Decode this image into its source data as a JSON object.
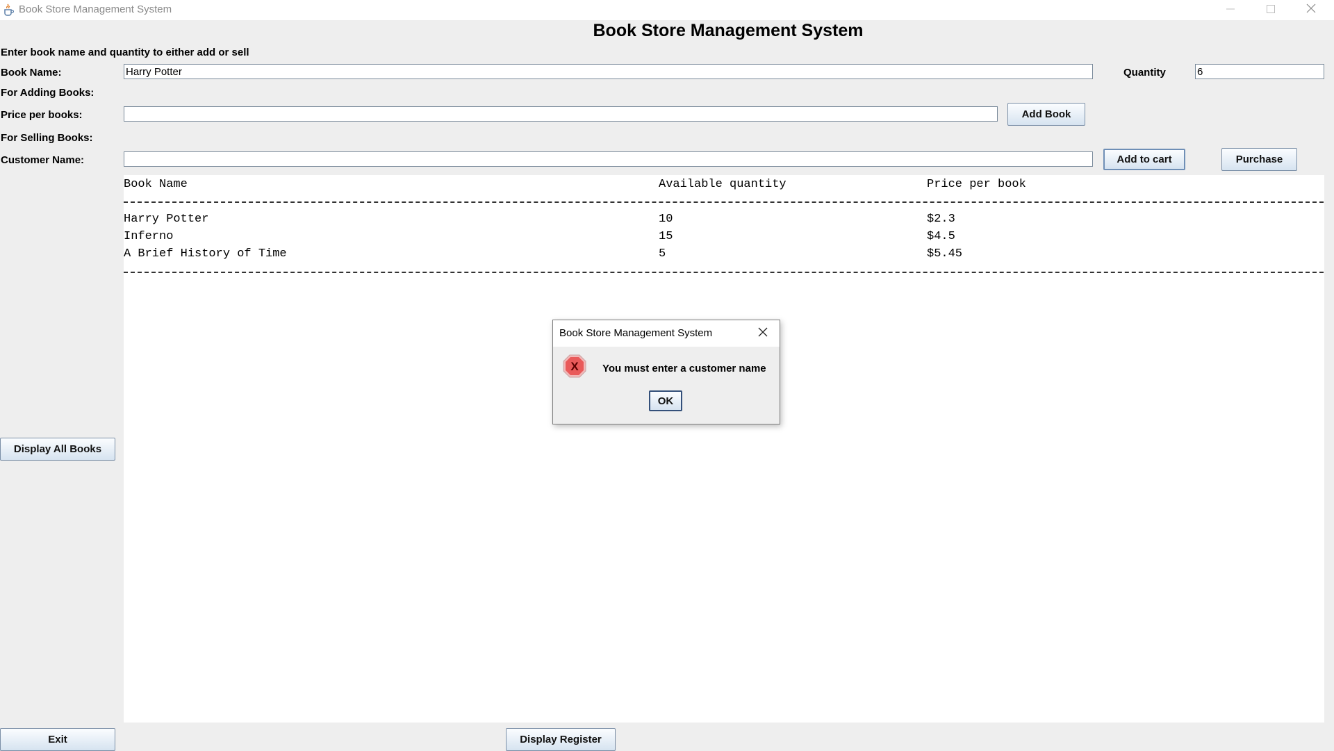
{
  "window": {
    "title": "Book Store Management System",
    "icons": {
      "app": "java-cup-icon",
      "minimize": "minimize-icon",
      "maximize": "maximize-icon",
      "close": "close-icon"
    }
  },
  "main": {
    "heading": "Book Store Management System",
    "instructions": "Enter book name and quantity to either add or sell",
    "book_name_label": "Book Name:",
    "book_name_value": "Harry Potter",
    "quantity_label": "Quantity",
    "quantity_value": "6",
    "adding_section_label": "For Adding Books:",
    "price_label": "Price per books:",
    "price_value": "",
    "add_book_label": "Add Book",
    "selling_section_label": "For Selling Books:",
    "customer_label": "Customer Name:",
    "customer_value": "",
    "add_to_cart_label": "Add to cart",
    "purchase_label": "Purchase"
  },
  "output": {
    "headers": [
      "Book Name",
      "Available quantity",
      "Price per book"
    ],
    "rows": [
      [
        "Harry Potter",
        "10",
        "$2.3"
      ],
      [
        "Inferno",
        "15",
        "$4.5"
      ],
      [
        "A Brief History of Time",
        "5",
        "$5.45"
      ]
    ]
  },
  "buttons": {
    "display_all": "Display All Books",
    "exit": "Exit",
    "display_register": "Display Register"
  },
  "dialog": {
    "title": "Book Store Management System",
    "message": "You must enter a customer name",
    "ok_label": "OK",
    "icon": "error-icon",
    "accent_color": "#d8232a"
  }
}
